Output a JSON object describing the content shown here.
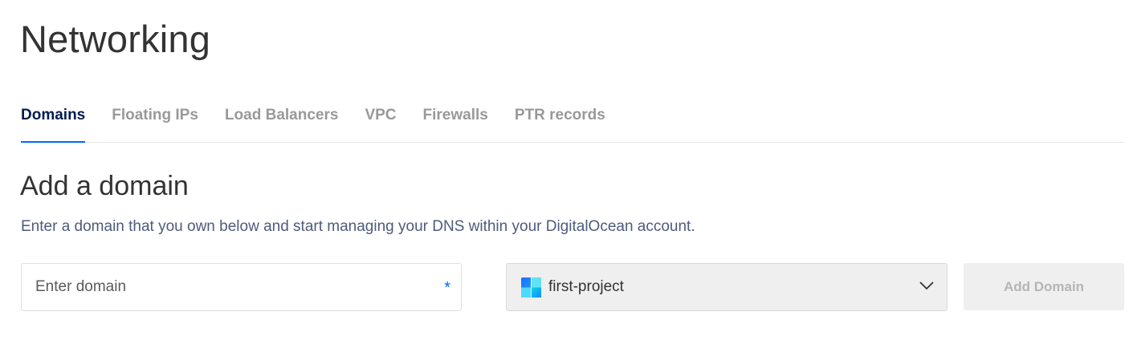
{
  "page": {
    "title": "Networking"
  },
  "tabs": [
    {
      "label": "Domains",
      "active": true
    },
    {
      "label": "Floating IPs",
      "active": false
    },
    {
      "label": "Load Balancers",
      "active": false
    },
    {
      "label": "VPC",
      "active": false
    },
    {
      "label": "Firewalls",
      "active": false
    },
    {
      "label": "PTR records",
      "active": false
    }
  ],
  "add_domain": {
    "heading": "Add a domain",
    "description": "Enter a domain that you own below and start managing your DNS within your DigitalOcean account.",
    "domain_input": {
      "placeholder": "Enter domain",
      "value": "",
      "required_marker": "*"
    },
    "project_select": {
      "selected": "first-project",
      "icon": "project-icon"
    },
    "submit_label": "Add Domain"
  },
  "colors": {
    "accent": "#0069ff",
    "active_tab": "#031b4e",
    "inactive_tab": "#999999",
    "disabled_button_bg": "#efefef",
    "disabled_button_text": "#b5b5b5"
  }
}
